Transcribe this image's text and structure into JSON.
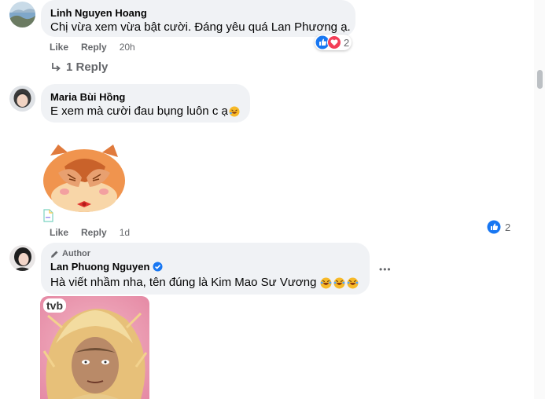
{
  "comments": [
    {
      "author": "Linh Nguyen Hoang",
      "text": "Chị vừa xem vừa bật cười. Đáng yêu quá Lan Phương ạ.",
      "like_label": "Like",
      "reply_label": "Reply",
      "time": "20h",
      "reaction_count": "2",
      "view_replies": "1 Reply"
    },
    {
      "author": "Maria Bùi Hồng",
      "text": "E xem mà cười đau bụng luôn c ạ",
      "like_label": "Like",
      "reply_label": "Reply",
      "time": "1d",
      "reaction_count": "2"
    },
    {
      "author_badge": "Author",
      "author": "Lan Phuong Nguyen",
      "text": "Hà viết nhầm nha, tên đúng là Kim Mao Sư Vương",
      "more_label": "•••",
      "image_logo": "tvb"
    }
  ],
  "icons": [
    "like-icon",
    "love-icon",
    "reply-arrow-icon",
    "laugh-emoji",
    "pencil-icon",
    "verified-icon",
    "more-icon"
  ],
  "colors": {
    "accent": "#1877f2",
    "bubble": "#f0f2f5",
    "meta": "#65676b",
    "love": "#f33e58"
  }
}
